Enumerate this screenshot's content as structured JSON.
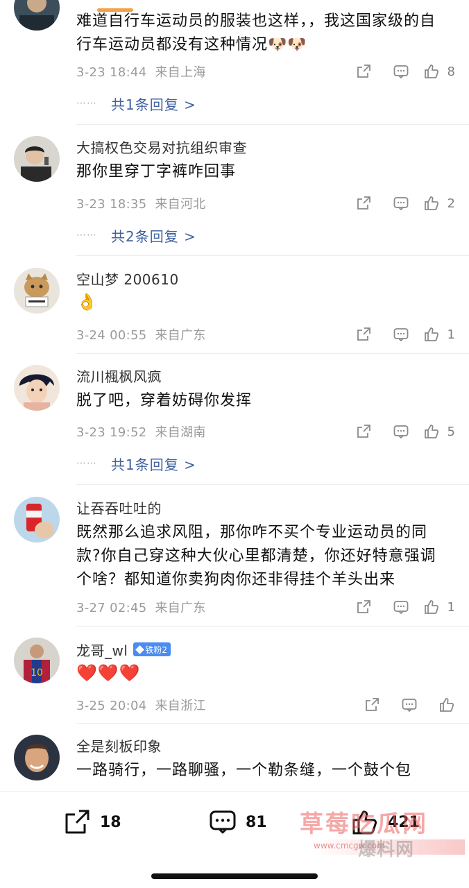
{
  "comments": [
    {
      "name": "",
      "text": "难道自行车运动员的服装也这样，，我这国家级的自行车运动员都没有这种情况🐶🐶",
      "time": "3-23 18:44",
      "location": "来自上海",
      "likes": "8",
      "replies": "共1条回复 >"
    },
    {
      "name": "大搞权色交易对抗组织审查",
      "text": "那你里穿丁字裤咋回事",
      "time": "3-23 18:35",
      "location": "来自河北",
      "likes": "2",
      "replies": "共2条回复 >"
    },
    {
      "name": "空山梦 200610",
      "text": "👌",
      "time": "3-24 00:55",
      "location": "来自广东",
      "likes": "1",
      "replies": ""
    },
    {
      "name": "流川楓枫风疯",
      "text": "脱了吧，穿着妨碍你发挥",
      "time": "3-23 19:52",
      "location": "来自湖南",
      "likes": "5",
      "replies": "共1条回复 >"
    },
    {
      "name": "让吞吞吐吐的",
      "text": "既然那么追求风阻，那你咋不买个专业运动员的同款?你自己穿这种大伙心里都清楚，你还好特意强调个啥？都知道你卖狗肉你还非得挂个羊头出来",
      "time": "3-27 02:45",
      "location": "来自广东",
      "likes": "1",
      "replies": ""
    },
    {
      "name": "龙哥_wl",
      "badge": "铁粉2",
      "text": "❤️❤️❤️",
      "time": "3-25 20:04",
      "location": "来自浙江",
      "likes": "",
      "replies": ""
    },
    {
      "name": "全是刻板印象",
      "text": "一路骑行，一路聊骚，一个勒条缝，一个鼓个包",
      "time": "",
      "location": "",
      "likes": "",
      "replies": ""
    }
  ],
  "bottom_bar": {
    "share_count": "18",
    "comment_count": "81",
    "like_count": "421"
  },
  "watermark": {
    "main": "草莓吃瓜网",
    "url": "www.cmcgw.com",
    "tag": "爆料网"
  },
  "icons": {
    "share": "share-icon",
    "comment": "comment-icon",
    "like": "thumbs-up-icon"
  },
  "colors": {
    "link_blue": "#41639f",
    "meta_gray": "#9b9b9b",
    "badge_blue": "#4a8cf0"
  }
}
